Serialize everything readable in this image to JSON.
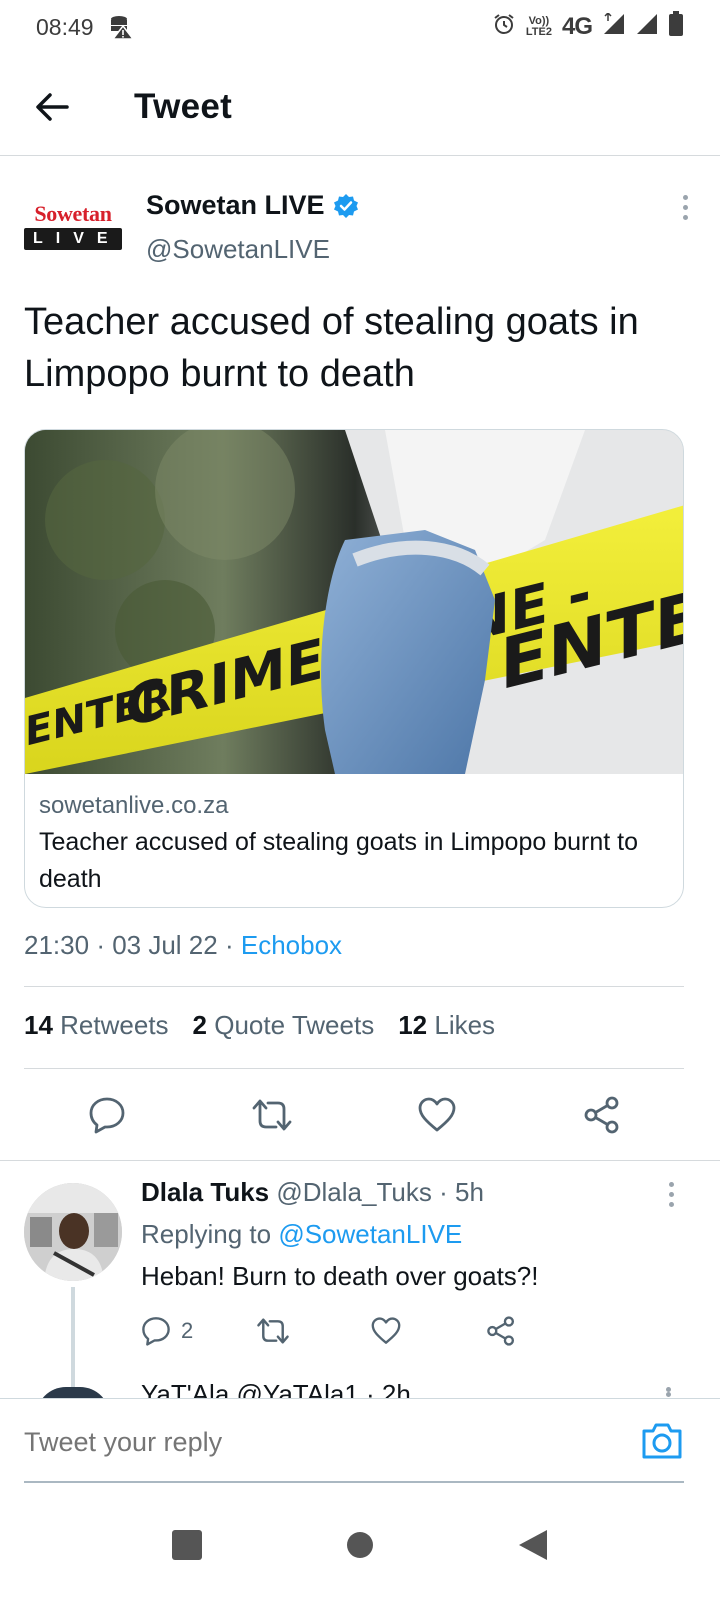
{
  "status_bar": {
    "time": "08:49",
    "network_label": "4G",
    "volte_top": "Vo))",
    "volte_bottom": "LTE2",
    "icons": [
      "storage-warning-icon",
      "alarm-icon",
      "signal-icon",
      "signal-icon",
      "battery-icon"
    ]
  },
  "header": {
    "title": "Tweet",
    "back_icon": "arrow-left-icon"
  },
  "tweet": {
    "author_name": "Sowetan LIVE",
    "author_handle": "@SowetanLIVE",
    "logo_top": "Sowetan",
    "logo_bottom": "LIVE",
    "verified": true,
    "text": "Teacher accused of stealing goats in Limpopo burnt to death",
    "card": {
      "image_tape_left": "CRIME SCENE -",
      "image_tape_right": "ENTER",
      "image_tape_far_left": "ENTER",
      "domain": "sowetanlive.co.za",
      "title": "Teacher accused of stealing goats in Limpopo burnt to death"
    },
    "time": "21:30",
    "date": "03 Jul 22",
    "source": "Echobox",
    "stats": {
      "retweets_count": "14",
      "retweets_label": "Retweets",
      "quotes_count": "2",
      "quotes_label": "Quote Tweets",
      "likes_count": "12",
      "likes_label": "Likes"
    },
    "actions": [
      "reply-icon",
      "retweet-icon",
      "like-icon",
      "share-icon"
    ]
  },
  "reply": {
    "name": "Dlala Tuks",
    "handle": "@Dlala_Tuks",
    "age": "5h",
    "replying_prefix": "Replying to",
    "replying_to": "@SowetanLIVE",
    "text": "Heban! Burn to death over goats?!",
    "reply_count": "2"
  },
  "next_reply_peek": {
    "text": "YaT'Ala @YaTAla1 · 2h"
  },
  "composer": {
    "placeholder": "Tweet your reply"
  },
  "colors": {
    "accent": "#1d9bf0",
    "text": "#0f1419",
    "muted": "#536471"
  }
}
